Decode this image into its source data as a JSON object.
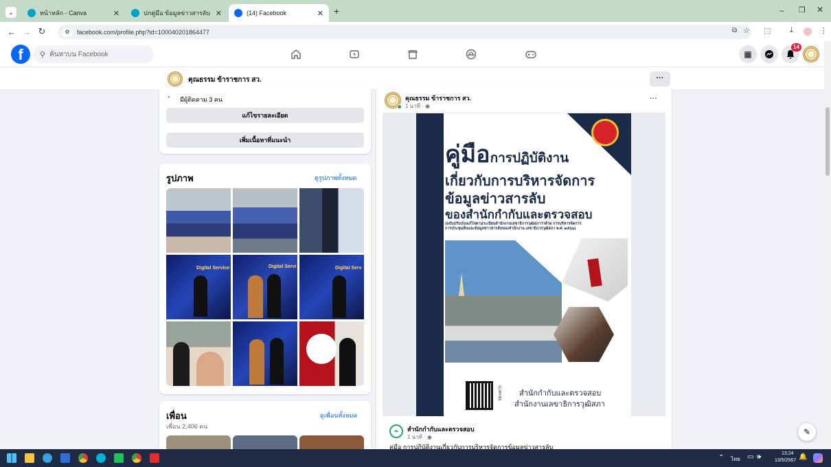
{
  "browser": {
    "tabs": [
      {
        "title": "หน้าหลัก - Canva",
        "active": false
      },
      {
        "title": "ปกคู่มือ ข้อมูลข่าวสารลับ - เอกสาร",
        "active": false
      },
      {
        "title": "(14) Facebook",
        "active": true
      }
    ],
    "url": "facebook.com/profile.php?id=100040201864477"
  },
  "facebook": {
    "search_placeholder": "ค้นหาบน Facebook",
    "notifications_count": "14"
  },
  "profile": {
    "name": "คุณธรรม ข้าราชการ สว."
  },
  "intro": {
    "followers_text": "มีผู้ติดตาม 3 คน",
    "edit_details_label": "แก้ไขรายละเอียด",
    "add_featured_label": "เพิ่มเนื้อหาที่แนะนำ"
  },
  "photos": {
    "title": "รูปภาพ",
    "see_all": "ดูรูปภาพทั้งหมด",
    "tile_texts": [
      "Digital Service",
      "Digital Servi",
      "Digital Serv"
    ]
  },
  "friends": {
    "title": "เพื่อน",
    "count_text": "เพื่อน 2,406 คน",
    "see_all": "ดูเพื่อนทั้งหมด"
  },
  "post": {
    "author": "คุณธรรม ข้าราชการ สว.",
    "time": "1 นาที · ",
    "poster": {
      "title_big": "คู่มือ",
      "title_rest": "การปฏิบัติงาน",
      "line2": "เกี่ยวกับการบริหารจัดการ",
      "line3": "ข้อมูลข่าวสารลับ",
      "line4": "ของสำนักกำกับและตรวจสอบ",
      "small_print": "(ฉบับปรับปรุงแก้ไขตามระเบียบสำนักงานเลขาธิการวุฒิสภาว่าด้วย การบริหารจัดการการประชุมลับและข้อมูลข่าวสารลับของสำนักงาน เลขาธิการวุฒิสภา พ.ศ. ๒๕๖๖)",
      "footer1": "สำนักกำกับและตรวจสอบ",
      "footer2": "สำนักงานเลขาธิการวุฒิสภา",
      "qr_label": "SCAN ME"
    },
    "shared_author": "สำนักกำกับและตรวจสอบ",
    "shared_time": "1 นาที · ",
    "caption": "คู่มือ การปฏิบัติงานเกี่ยวกับการบริหารจัดการข้อมูลข่าวสารลับ"
  },
  "taskbar": {
    "language": "ไทย",
    "time": "13:24",
    "date": "13/5/2567"
  },
  "colors": {
    "fb_blue": "#0866ff",
    "tab_strip": "#c4dbc9",
    "taskbar": "#1f2a44",
    "poster_navy": "#1b2a47"
  }
}
